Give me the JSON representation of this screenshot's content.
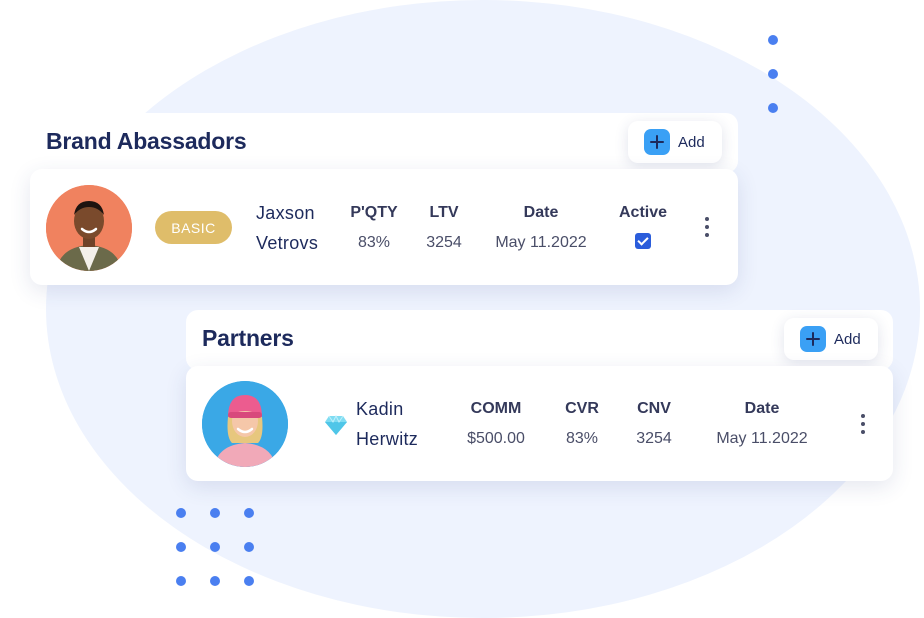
{
  "colors": {
    "accent": "#3aa0f5",
    "navy": "#1d2a5c",
    "badge": "#dfbd6a",
    "checkbox": "#2b5ddb",
    "dots": "#4a7ff0"
  },
  "ambassadors": {
    "title": "Brand Abassadors",
    "add_label": "Add",
    "row": {
      "avatar_icon": "man-avatar",
      "badge": "BASIC",
      "first_name": "Jaxson",
      "last_name": "Vetrovs",
      "columns": [
        {
          "label": "P'QTY",
          "value": "83%"
        },
        {
          "label": "LTV",
          "value": "3254"
        },
        {
          "label": "Date",
          "value": "May 11.2022"
        }
      ],
      "active_label": "Active",
      "active": true
    }
  },
  "partners": {
    "title": "Partners",
    "add_label": "Add",
    "row": {
      "avatar_icon": "woman-avatar",
      "tier_icon": "diamond-icon",
      "first_name": "Kadin",
      "last_name": "Herwitz",
      "columns": [
        {
          "label": "COMM",
          "value": "$500.00"
        },
        {
          "label": "CVR",
          "value": "83%"
        },
        {
          "label": "CNV",
          "value": "3254"
        },
        {
          "label": "Date",
          "value": "May 11.2022"
        }
      ]
    }
  }
}
